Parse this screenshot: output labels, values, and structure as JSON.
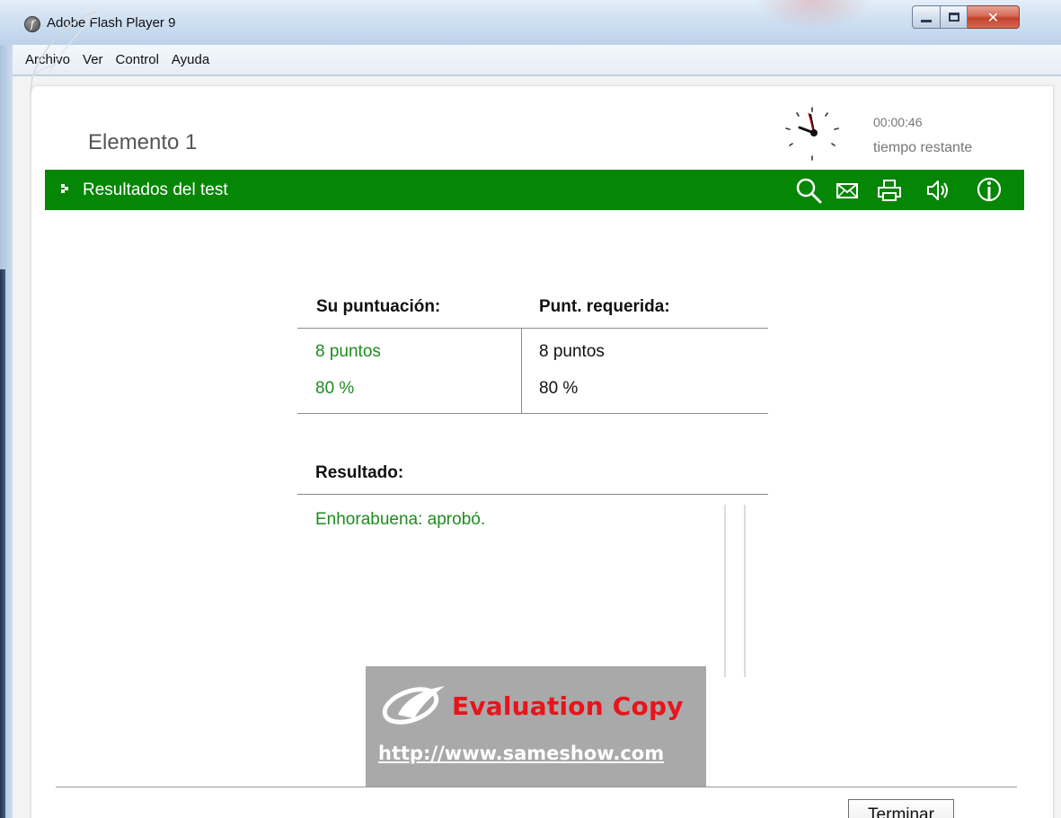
{
  "window": {
    "title": "Adobe Flash Player 9",
    "buttons": {
      "minimize": "minimize",
      "maximize": "maximize",
      "close": "close"
    }
  },
  "menu": {
    "items": [
      "Archivo",
      "Ver",
      "Control",
      "Ayuda"
    ]
  },
  "header": {
    "element_title": "Elemento 1",
    "timer": {
      "value": "00:00:46",
      "label": "tiempo restante"
    }
  },
  "toolbar": {
    "title": "Resultados del test",
    "icons": [
      "search-icon",
      "mail-icon",
      "print-icon",
      "sound-icon",
      "info-icon"
    ]
  },
  "scores": {
    "your_header": "Su puntuación:",
    "required_header": "Punt. requerida:",
    "your_points": "8 puntos",
    "your_percent": "80 %",
    "required_points": "8 puntos",
    "required_percent": "80 %"
  },
  "result": {
    "label": "Resultado:",
    "text": "Enhorabuena: aprobó."
  },
  "watermark": {
    "title": "Evaluation Copy",
    "url": "http://www.sameshow.com"
  },
  "footer": {
    "finish_label": "Terminar"
  },
  "colors": {
    "accent_green": "#058605",
    "pass_text": "#1f8b1f",
    "watermark_red": "#e8141c"
  }
}
